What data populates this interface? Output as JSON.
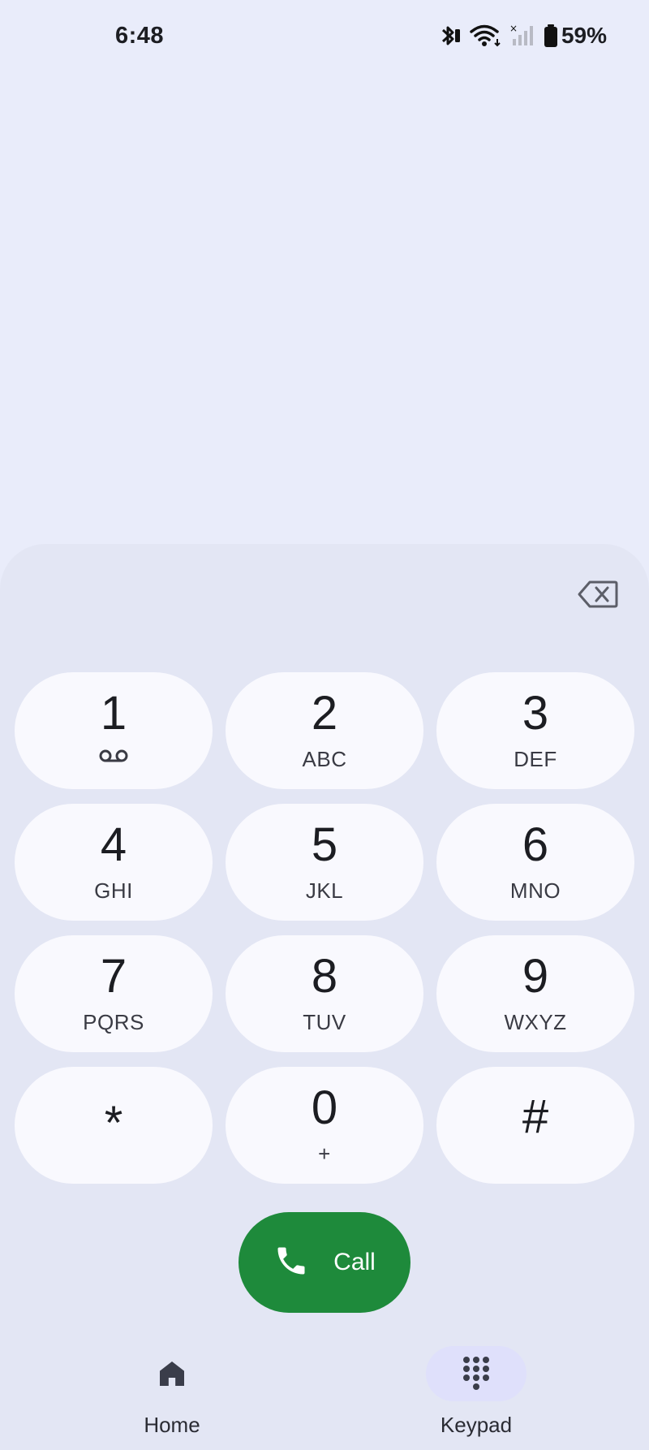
{
  "status_bar": {
    "time": "6:48",
    "battery_percent": "59%",
    "icons": [
      "bluetooth-icon",
      "wifi-icon",
      "cell-signal-icon",
      "battery-icon"
    ]
  },
  "keypad": {
    "keys": [
      {
        "digit": "1",
        "letters": "",
        "icon": "voicemail-icon"
      },
      {
        "digit": "2",
        "letters": "ABC"
      },
      {
        "digit": "3",
        "letters": "DEF"
      },
      {
        "digit": "4",
        "letters": "GHI"
      },
      {
        "digit": "5",
        "letters": "JKL"
      },
      {
        "digit": "6",
        "letters": "MNO"
      },
      {
        "digit": "7",
        "letters": "PQRS"
      },
      {
        "digit": "8",
        "letters": "TUV"
      },
      {
        "digit": "9",
        "letters": "WXYZ"
      },
      {
        "digit": "*",
        "letters": ""
      },
      {
        "digit": "0",
        "letters": "+"
      },
      {
        "digit": "#",
        "letters": ""
      }
    ],
    "backspace_icon": "backspace-icon"
  },
  "call_button": {
    "label": "Call",
    "icon": "phone-icon",
    "color": "#1e8a3b"
  },
  "bottom_nav": {
    "items": [
      {
        "label": "Home",
        "icon": "home-icon",
        "selected": false
      },
      {
        "label": "Keypad",
        "icon": "dialpad-icon",
        "selected": true
      }
    ]
  },
  "colors": {
    "background": "#e9ecfa",
    "sheet": "#e3e6f4",
    "key": "#f9f9fe",
    "nav_selected": "#dfe0fb"
  }
}
